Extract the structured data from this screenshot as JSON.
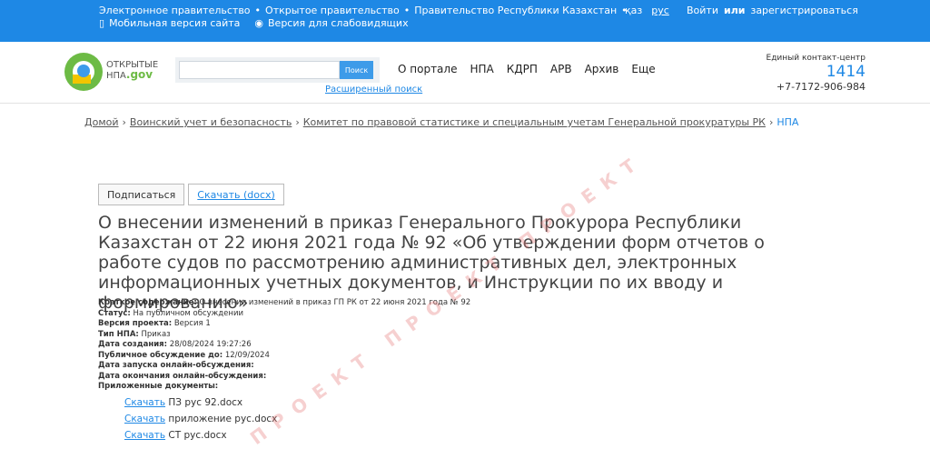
{
  "topbar": {
    "links": [
      "Электронное правительство",
      "Открытое правительство",
      "Правительство Республики Казахстан"
    ],
    "mobile": "Мобильная версия сайта",
    "impaired": "Версия для слабовидящих",
    "lang": [
      "қаз",
      "рус"
    ],
    "login": "Войти",
    "or": "или",
    "register": "зарегистрироваться",
    "color": "#1e88e5"
  },
  "logo": {
    "line1": "ОТКРЫТЫЕ",
    "line2": "НПА",
    "gov": ".gov"
  },
  "search": {
    "value": "",
    "button": "Поиск",
    "advanced": "Расширенный поиск"
  },
  "nav": [
    "О портале",
    "НПА",
    "КДРП",
    "АРВ",
    "Архив",
    "Еще"
  ],
  "contact": {
    "label": "Единый контакт-центр",
    "number": "1414",
    "phone": "+7-7172-906-984"
  },
  "breadcrumbs": [
    "Домой",
    "Воинский учет и безопасность",
    "Комитет по правовой статистике и специальным учетам Генеральной прокуратуры РК",
    "НПА"
  ],
  "actions": {
    "sign": "Подписаться",
    "download": "Скачать (docx)"
  },
  "title": "О внесении изменений в приказ Генерального Прокурора Республики Казахстан от 22 июня 2021 года № 92 «Об утверждении форм отчетов о работе судов по рассмотрению административных дел, электронных информационных учетных документов, и Инструкции по их вводу и формированию»",
  "meta": [
    {
      "label": "Краткое содержание:",
      "value": "О внесении изменений в приказ ГП РК от 22 июня 2021 года № 92"
    },
    {
      "label": "Статус:",
      "value": "На публичном обсуждении"
    },
    {
      "label": "Версия проекта:",
      "value": "Версия 1"
    },
    {
      "label": "Тип НПА:",
      "value": "Приказ"
    },
    {
      "label": "Дата создания:",
      "value": "28/08/2024 19:27:26"
    },
    {
      "label": "Публичное обсуждение до:",
      "value": "12/09/2024"
    },
    {
      "label": "Дата запуска онлайн-обсуждения:",
      "value": ""
    },
    {
      "label": "Дата окончания онлайн-обсуждения:",
      "value": ""
    },
    {
      "label": "Приложенные документы:",
      "value": ""
    }
  ],
  "documents": [
    {
      "link": "Скачать",
      "name": "ПЗ рус 92.docx"
    },
    {
      "link": "Скачать",
      "name": "приложение рус.docx"
    },
    {
      "link": "Скачать",
      "name": "СТ рус.docx"
    }
  ],
  "watermark": "ПРОЕКТ ПРОЕКТ ПРОЕКТ"
}
